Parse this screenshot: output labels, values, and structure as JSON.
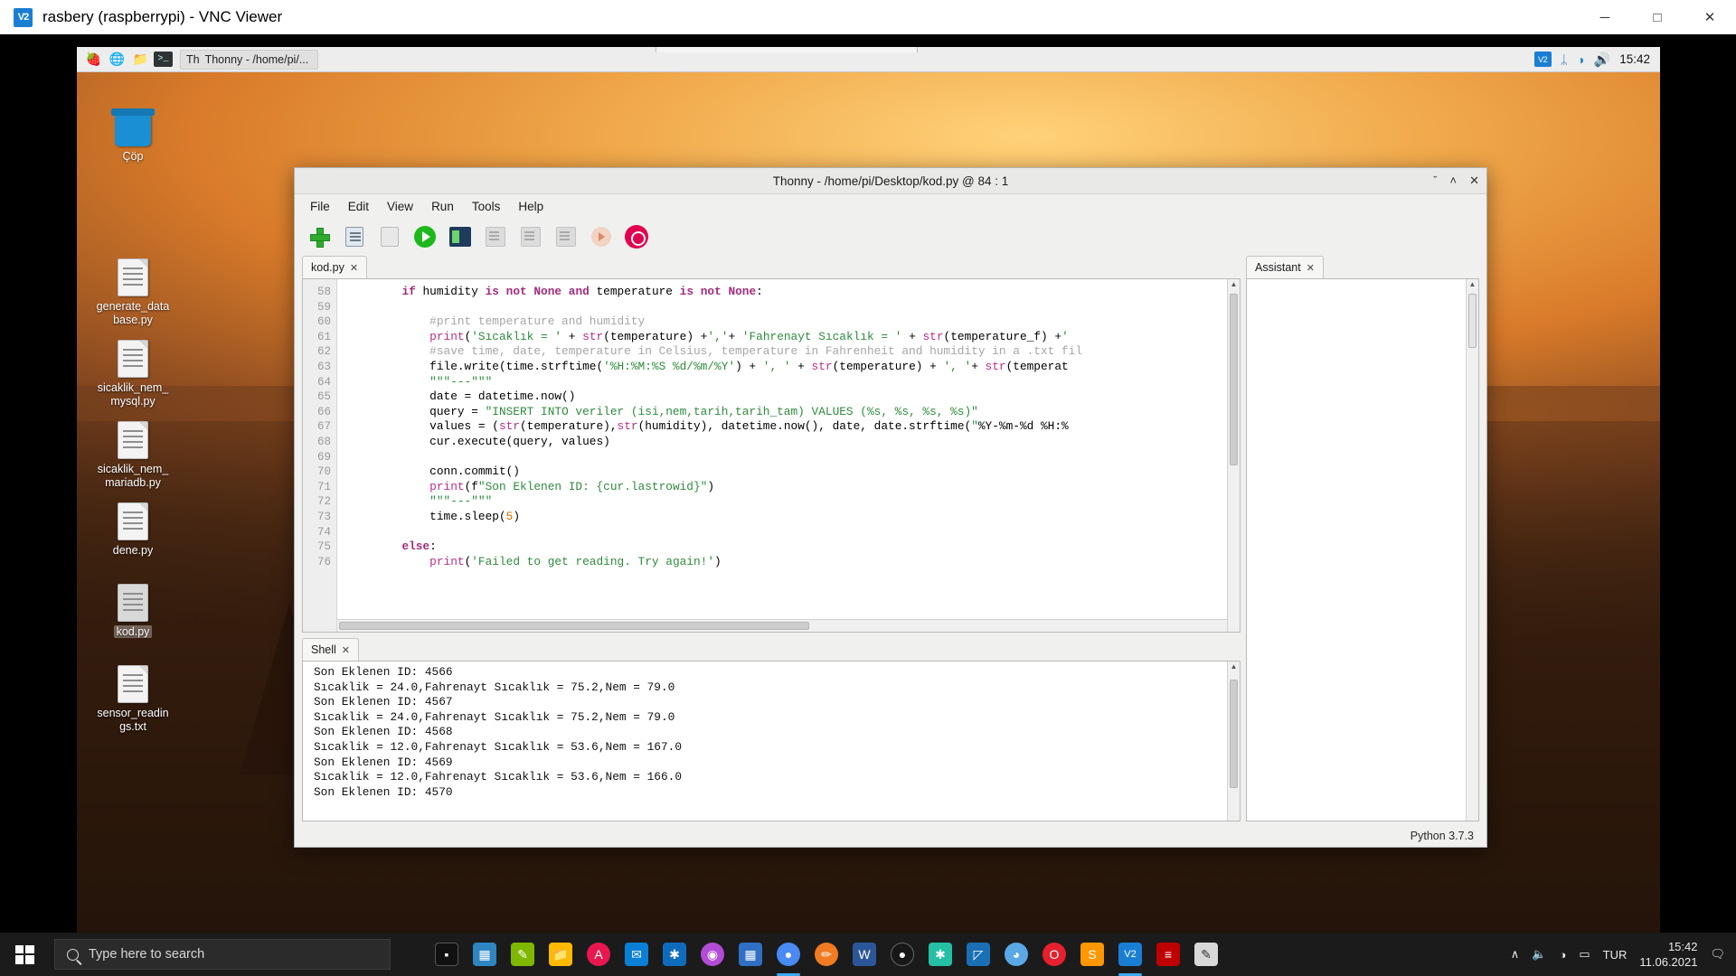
{
  "vnc": {
    "logo_text": "V2",
    "title": "rasbery (raspberrypi) - VNC Viewer",
    "minimize": "─",
    "maximize": "□",
    "close": "✕"
  },
  "pi_taskbar": {
    "icons": [
      {
        "name": "raspberry-menu-icon",
        "glyph": "❦"
      },
      {
        "name": "web-browser-icon",
        "glyph": "ἱ0"
      },
      {
        "name": "file-manager-icon",
        "glyph": "▰"
      },
      {
        "name": "terminal-icon",
        "glyph": ">_"
      }
    ],
    "task_button": {
      "icon": "Th",
      "label": "Thonny  -  /home/pi/..."
    },
    "tray": {
      "vnc": "V2",
      "bluetooth": "ᛦ",
      "wifi": "◠",
      "volume": "ὐa",
      "clock": "15:42"
    }
  },
  "desktop_icons": [
    {
      "name": "trash",
      "label": "Çöp",
      "type": "trash",
      "selected": false
    },
    {
      "name": "generate-database",
      "label": "generate_data\nbase.py",
      "type": "file",
      "selected": false
    },
    {
      "name": "sicaklik-nem-mysql",
      "label": "sicaklik_nem_\nmysql.py",
      "type": "file",
      "selected": false
    },
    {
      "name": "sicaklik-nem-mariadb",
      "label": "sicaklik_nem_\nmariadb.py",
      "type": "file",
      "selected": false
    },
    {
      "name": "dene",
      "label": "dene.py",
      "type": "file",
      "selected": false
    },
    {
      "name": "kod",
      "label": "kod.py",
      "type": "file",
      "selected": true
    },
    {
      "name": "sensor-readings",
      "label": "sensor_readin\ngs.txt",
      "type": "file",
      "selected": false
    }
  ],
  "thonny": {
    "title": "Thonny  -  /home/pi/Desktop/kod.py @  84 : 1",
    "win_buttons": {
      "minimize": "ˇ",
      "maximize": "˄",
      "close": "✕"
    },
    "menu": [
      "File",
      "Edit",
      "View",
      "Run",
      "Tools",
      "Help"
    ],
    "toolbar": [
      {
        "name": "new-file-button",
        "icon": "plus"
      },
      {
        "name": "load-file-button",
        "icon": "load"
      },
      {
        "name": "save-file-button",
        "icon": "save"
      },
      {
        "name": "run-button",
        "icon": "run"
      },
      {
        "name": "debug-button",
        "icon": "debug"
      },
      {
        "name": "step-over-button",
        "icon": "step"
      },
      {
        "name": "step-into-button",
        "icon": "step"
      },
      {
        "name": "step-out-button",
        "icon": "step"
      },
      {
        "name": "resume-button",
        "icon": "resume"
      },
      {
        "name": "stop-button",
        "icon": "stop"
      }
    ],
    "editor_tab": {
      "label": "kod.py",
      "close": "✕"
    },
    "shell_tab": {
      "label": "Shell",
      "close": "✕"
    },
    "assistant_tab": {
      "label": "Assistant",
      "close": "✕"
    },
    "status": "Python 3.7.3",
    "first_line_number": 58,
    "code_lines": [
      "        if humidity is not None and temperature is not None:",
      "",
      "            #print temperature and humidity",
      "            print('Sıcaklık = ' + str(temperature) +','+ 'Fahrenayt Sıcaklık = ' + str(temperature_f) +'",
      "            #save time, date, temperature in Celsius, temperature in Fahrenheit and humidity in a .txt fil",
      "            file.write(time.strftime('%H:%M:%S %d/%m/%Y') + ', ' + str(temperature) + ', '+ str(temperat",
      "            \"\"\"---\"\"\"",
      "            date = datetime.now()",
      "            query = \"INSERT INTO veriler (isi,nem,tarih,tarih_tam) VALUES (%s, %s, %s, %s)\"",
      "            values = (str(temperature),str(humidity), datetime.now(), date, date.strftime(\"%Y-%m-%d %H:%",
      "            cur.execute(query, values)",
      "",
      "            conn.commit()",
      "            print(f\"Son Eklenen ID: {cur.lastrowid}\")",
      "            \"\"\"---\"\"\"",
      "            time.sleep(5)",
      "",
      "        else:",
      "            print('Failed to get reading. Try again!')"
    ],
    "shell_lines": [
      "Son Eklenen ID: 4566",
      "Sıcaklik = 24.0,Fahrenayt Sıcaklık = 75.2,Nem = 79.0",
      "Son Eklenen ID: 4567",
      "Sıcaklik = 24.0,Fahrenayt Sıcaklık = 75.2,Nem = 79.0",
      "Son Eklenen ID: 4568",
      "Sıcaklik = 12.0,Fahrenayt Sıcaklık = 53.6,Nem = 167.0",
      "Son Eklenen ID: 4569",
      "Sıcaklik = 12.0,Fahrenayt Sıcaklık = 53.6,Nem = 166.0",
      "Son Eklenen ID: 4570"
    ]
  },
  "win_taskbar": {
    "start_label": "Start",
    "search_placeholder": "Type here to search",
    "apps": [
      {
        "name": "task-view-icon",
        "glyph": "▣",
        "color": "#1e1e1e",
        "active": false
      },
      {
        "name": "calculator-icon",
        "glyph": "⌸",
        "color": "#2e86c1",
        "active": false
      },
      {
        "name": "notes-icon",
        "glyph": "✎",
        "color": "#7fb800",
        "active": false
      },
      {
        "name": "file-explorer-icon",
        "glyph": "▰",
        "color": "#ffb900",
        "active": false
      },
      {
        "name": "translator-icon",
        "glyph": "A",
        "color": "#e8174f",
        "active": false
      },
      {
        "name": "mail-icon",
        "glyph": "✉",
        "color": "#0a7fd6",
        "active": false
      },
      {
        "name": "vscode-icon",
        "glyph": "⬡",
        "color": "#0f6cbd",
        "active": false
      },
      {
        "name": "media-player-icon",
        "glyph": "◉",
        "color": "#b24cd6",
        "active": false
      },
      {
        "name": "calendar-icon",
        "glyph": "▦",
        "color": "#2f6fc4",
        "active": false
      },
      {
        "name": "chrome-icon",
        "glyph": "●",
        "color": "#4a8af4",
        "active": true
      },
      {
        "name": "paint-icon",
        "glyph": "✏",
        "color": "#f07b22",
        "active": false
      },
      {
        "name": "word-icon",
        "glyph": "W",
        "color": "#2b579a",
        "active": false
      },
      {
        "name": "github-icon",
        "glyph": "●",
        "color": "#181717",
        "active": false
      },
      {
        "name": "vscode-insiders-icon",
        "glyph": "⬡",
        "color": "#24bfa5",
        "active": false
      },
      {
        "name": "photos-icon",
        "glyph": "◰",
        "color": "#1a6fb5",
        "active": false
      },
      {
        "name": "browser-icon",
        "glyph": "◑",
        "color": "#5aa9e6",
        "active": false
      },
      {
        "name": "opera-icon",
        "glyph": "O",
        "color": "#e6202e",
        "active": false
      },
      {
        "name": "sublime-icon",
        "glyph": "S",
        "color": "#ff9800",
        "active": false
      },
      {
        "name": "vnc-viewer-icon",
        "glyph": "V2",
        "color": "#1a7fd4",
        "active": true
      },
      {
        "name": "filezilla-icon",
        "glyph": "≡",
        "color": "#bf0000",
        "active": false
      },
      {
        "name": "editor-icon",
        "glyph": "✍",
        "color": "#d8d8d8",
        "active": false
      }
    ],
    "tray": {
      "chevron": "∧",
      "volume": "ὐa",
      "network": "◠",
      "battery": "▭",
      "language": "TUR",
      "time": "15:42",
      "date": "11.06.2021",
      "notifications": "▤"
    }
  }
}
